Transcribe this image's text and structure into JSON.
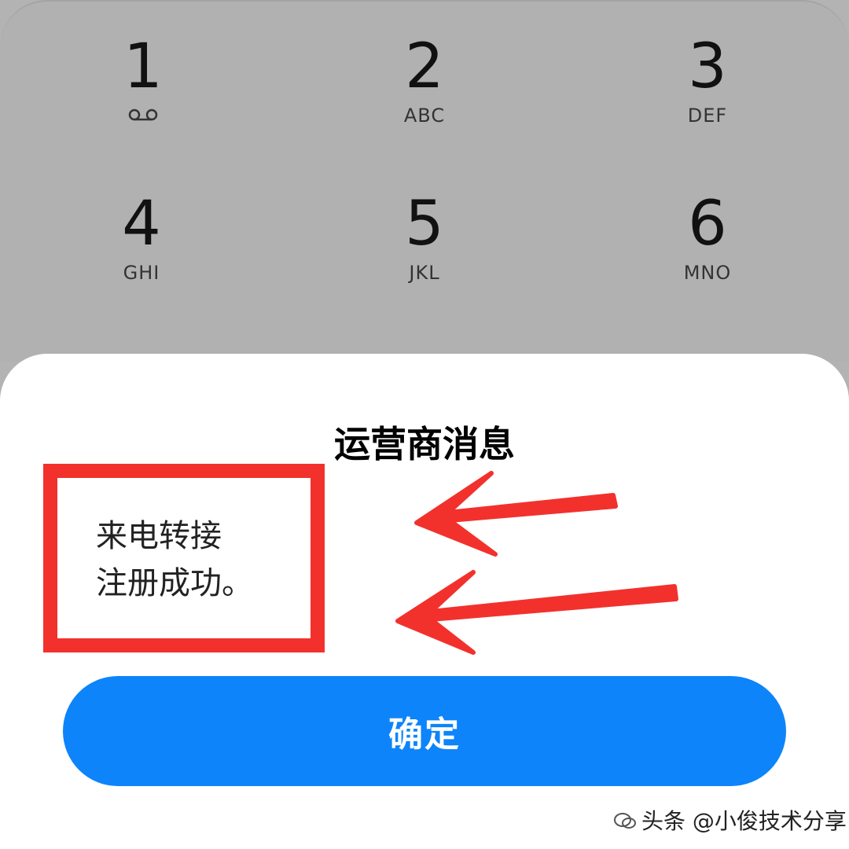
{
  "dialpad": {
    "keys": [
      {
        "digit": "1",
        "letters": "",
        "icon": "voicemail-icon"
      },
      {
        "digit": "2",
        "letters": "ABC"
      },
      {
        "digit": "3",
        "letters": "DEF"
      },
      {
        "digit": "4",
        "letters": "GHI"
      },
      {
        "digit": "5",
        "letters": "JKL"
      },
      {
        "digit": "6",
        "letters": "MNO"
      }
    ]
  },
  "dialog": {
    "title": "运营商消息",
    "message_line1": "来电转接",
    "message_line2": "注册成功。",
    "confirm_label": "确定"
  },
  "annotation": {
    "color": "#f2312d"
  },
  "watermark": {
    "text": "头条 @小俊技术分享"
  },
  "colors": {
    "accent": "#0d84fa",
    "overlay": "#b1b1b1"
  }
}
